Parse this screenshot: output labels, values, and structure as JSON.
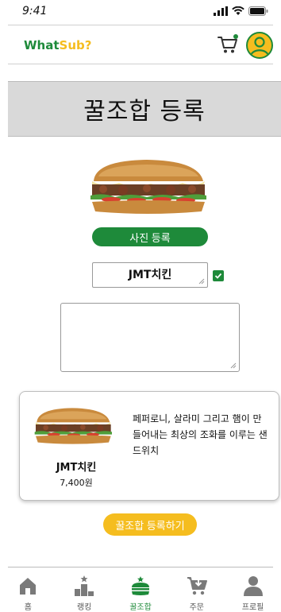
{
  "status_bar": {
    "time": "9:41"
  },
  "header": {
    "logo_what": "What",
    "logo_sub": "Sub?",
    "brand_green": "#1e8a3a",
    "brand_yellow": "#f5bd1f"
  },
  "page": {
    "title": "꿀조합 등록"
  },
  "form": {
    "photo_button_label": "사진 등록",
    "name_value": "JMT치킨",
    "name_checked": true,
    "description_value": ""
  },
  "preview": {
    "name": "JMT치킨",
    "price": "7,400원",
    "description": "페퍼로니, 살라미 그리고 햄이 만들어내는 최상의 조화를 이루는 샌드위치"
  },
  "submit_button_label": "꿀조합 등록하기",
  "bottom_nav": {
    "items": [
      {
        "label": "홈",
        "icon": "home-icon",
        "active": false
      },
      {
        "label": "랭킹",
        "icon": "podium-icon",
        "active": false
      },
      {
        "label": "꿀조합",
        "icon": "sandwich-combo-icon",
        "active": true
      },
      {
        "label": "주문",
        "icon": "cart-order-icon",
        "active": false
      },
      {
        "label": "프로필",
        "icon": "profile-icon",
        "active": false
      }
    ]
  }
}
